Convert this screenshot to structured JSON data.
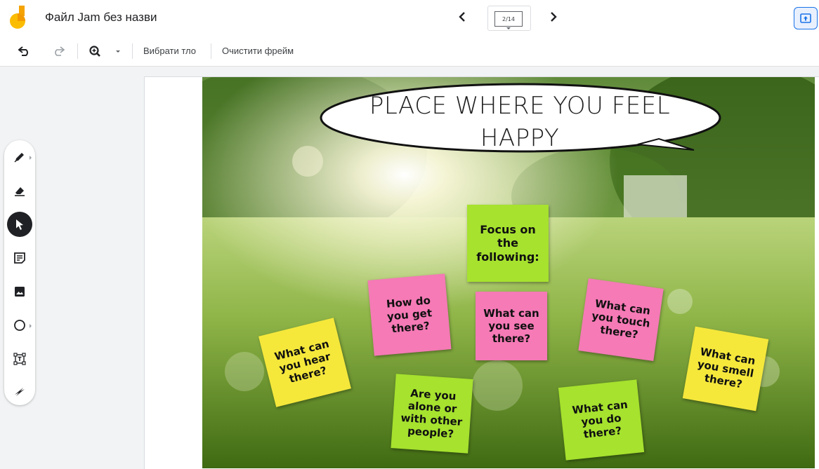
{
  "app": {
    "document_title": "Файл Jam без назви",
    "frame_indicator": "2/14"
  },
  "toolbar": {
    "set_background_label": "Вибрати тло",
    "clear_frame_label": "Очистити фрейм"
  },
  "icons": {
    "undo": "undo-icon",
    "redo": "redo-icon",
    "zoom": "zoom-in-icon",
    "pen": "pen-icon",
    "eraser": "eraser-icon",
    "select": "pointer-icon",
    "sticky": "sticky-note-icon",
    "image": "image-icon",
    "shape": "circle-icon",
    "textbox": "text-box-icon",
    "laser": "laser-icon"
  },
  "colors": {
    "sticky_green": "#a6e22e",
    "sticky_pink": "#f57ab6",
    "sticky_yellow": "#f5e83b",
    "accent": "#1a73e8"
  },
  "canvas": {
    "heading": "PLACE WHERE YOU FEEL HAPPY",
    "stickies": {
      "focus": "Focus on the following:",
      "get_there": "How do you get there?",
      "see": "What can you see there?",
      "touch": "What can you touch there?",
      "hear": "What can you hear there?",
      "smell": "What can you smell there?",
      "alone": "Are you alone or with other people?",
      "do": "What can you do there?"
    }
  }
}
